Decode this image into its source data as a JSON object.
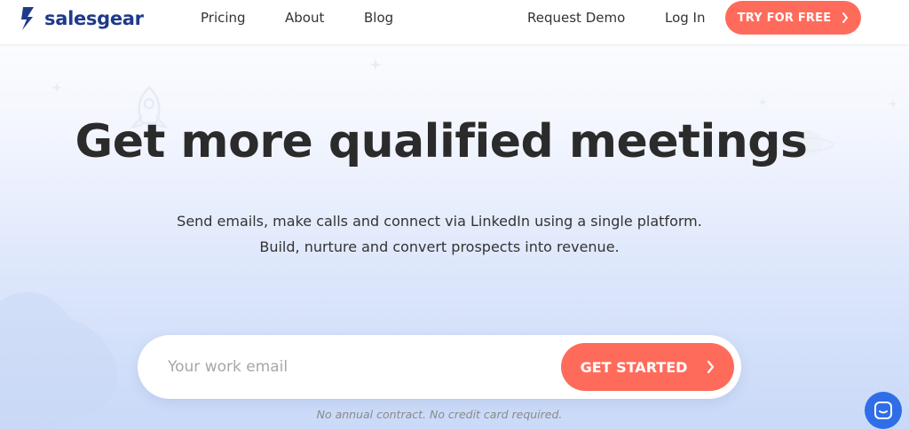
{
  "brand": {
    "name": "salesgear",
    "color": "#1f3a8a"
  },
  "nav": {
    "links": [
      "Pricing",
      "About",
      "Blog",
      "Request Demo",
      "Log In"
    ],
    "cta_label": "TRY FOR FREE"
  },
  "hero": {
    "headline": "Get more qualified meetings",
    "subline_1": "Send emails, make calls and connect via LinkedIn using a single platform.",
    "subline_2": "Build, nurture and convert prospects into revenue."
  },
  "signup": {
    "placeholder": "Your work email",
    "value": "",
    "button_label": "GET STARTED",
    "note": "No annual contract. No credit card required."
  },
  "colors": {
    "accent": "#ff6b5b",
    "headline": "#2b2b2b",
    "chat": "#2f6ee8"
  },
  "icons": [
    "logo-icon",
    "chevron-right-icon",
    "rocket-icon",
    "planet-icon",
    "star-icon",
    "chat-icon"
  ]
}
